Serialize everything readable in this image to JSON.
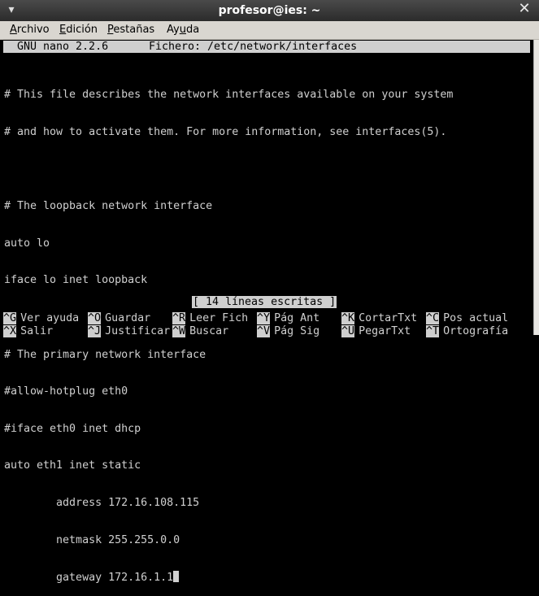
{
  "window": {
    "title": "profesor@ies: ~"
  },
  "menubar": {
    "items": [
      {
        "pre": "",
        "u": "A",
        "post": "rchivo"
      },
      {
        "pre": "",
        "u": "E",
        "post": "dición"
      },
      {
        "pre": "",
        "u": "P",
        "post": "estañas"
      },
      {
        "pre": "Ay",
        "u": "u",
        "post": "da"
      }
    ]
  },
  "nano": {
    "version": "GNU nano 2.2.6",
    "file_label": "Fichero: /etc/network/interfaces",
    "lines": [
      "# This file describes the network interfaces available on your system",
      "# and how to activate them. For more information, see interfaces(5).",
      "",
      "# The loopback network interface",
      "auto lo",
      "iface lo inet loopback",
      "",
      "# The primary network interface",
      "#allow-hotplug eth0",
      "#iface eth0 inet dhcp",
      "auto eth1 inet static",
      "        address 172.16.108.115",
      "        netmask 255.255.0.0",
      "        gateway 172.16.1.1"
    ],
    "status": "[ 14 líneas escritas ]",
    "shortcuts": [
      {
        "key": "^G",
        "label": "Ver ayuda"
      },
      {
        "key": "^O",
        "label": "Guardar"
      },
      {
        "key": "^R",
        "label": "Leer Fich"
      },
      {
        "key": "^Y",
        "label": "Pág Ant"
      },
      {
        "key": "^K",
        "label": "CortarTxt"
      },
      {
        "key": "^C",
        "label": "Pos actual"
      },
      {
        "key": "^X",
        "label": "Salir"
      },
      {
        "key": "^J",
        "label": "Justificar"
      },
      {
        "key": "^W",
        "label": "Buscar"
      },
      {
        "key": "^V",
        "label": "Pág Sig"
      },
      {
        "key": "^U",
        "label": "PegarTxt"
      },
      {
        "key": "^T",
        "label": "Ortografía"
      }
    ]
  }
}
